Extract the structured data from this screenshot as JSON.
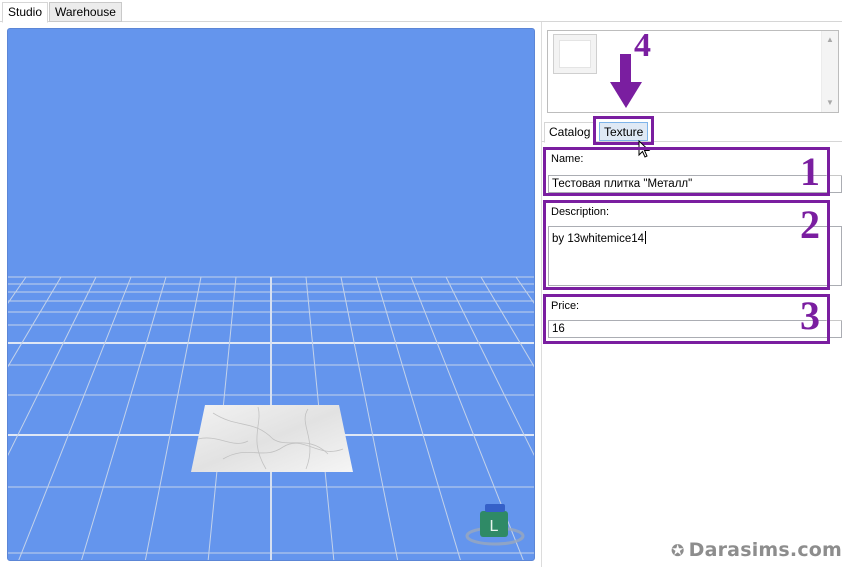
{
  "top_tabs": [
    {
      "label": "Studio",
      "active": true
    },
    {
      "label": "Warehouse",
      "active": false
    }
  ],
  "inner_tabs": [
    {
      "label": "Catalog",
      "active": true
    },
    {
      "label": "Texture",
      "active": false
    }
  ],
  "fields": {
    "name": {
      "label": "Name:",
      "value": "Тестовая плитка \"Металл\""
    },
    "description": {
      "label": "Description:",
      "value": "by 13whitemice14"
    },
    "price": {
      "label": "Price:",
      "value": "16"
    }
  },
  "annotations": {
    "n1": "1",
    "n2": "2",
    "n3": "3",
    "n4": "4"
  },
  "viewport": {
    "gizmo_label": "L",
    "background_color": "#6495ed"
  },
  "colors": {
    "annotation": "#7a1ea0",
    "tab_highlight": "#dfe9f5"
  },
  "watermark": {
    "icon": "star-icon",
    "text": "Darasims.com"
  }
}
